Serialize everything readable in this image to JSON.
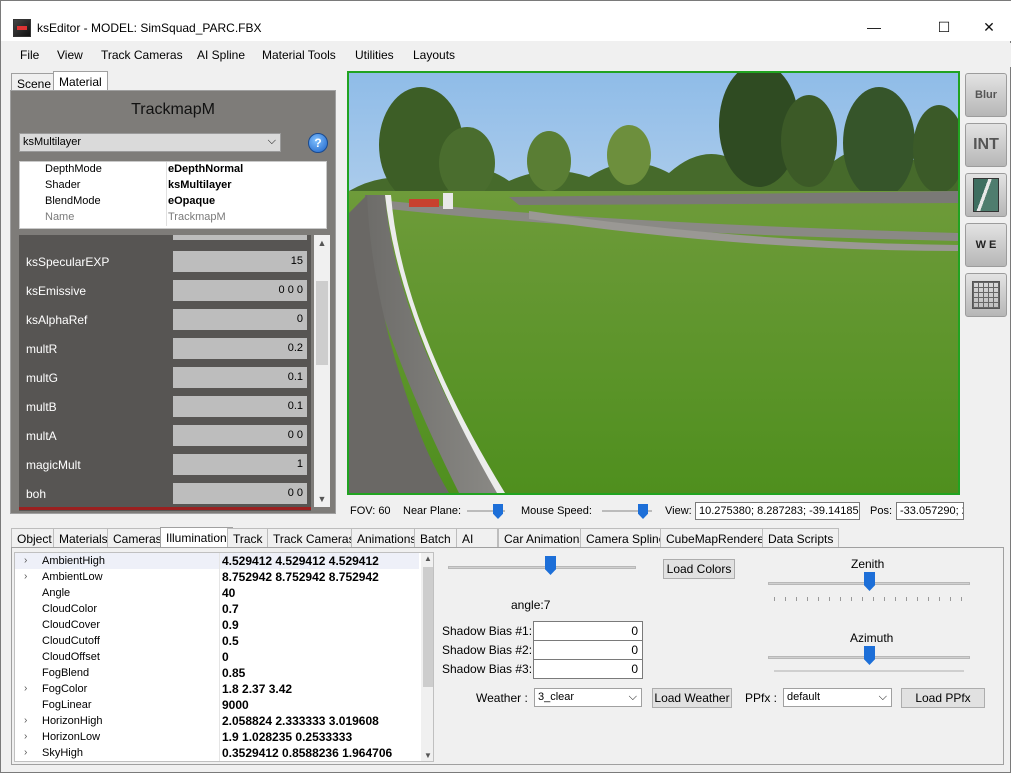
{
  "window": {
    "title": "ksEditor - MODEL: SimSquad_PARC.FBX",
    "minimize": "—",
    "maximize": "☐",
    "close": "✕"
  },
  "menu": [
    "File",
    "View",
    "Track Cameras",
    "AI Spline",
    "Material Tools",
    "Utilities",
    "Layouts"
  ],
  "left_tabs": [
    "Scene",
    "Material"
  ],
  "material": {
    "name": "TrackmapM",
    "shader_select": "ksMultilayer",
    "help_label": "?",
    "properties": [
      {
        "key": "DepthMode",
        "value": "eDepthNormal"
      },
      {
        "key": "Shader",
        "value": "ksMultilayer"
      },
      {
        "key": "BlendMode",
        "value": "eOpaque"
      },
      {
        "key": "Name",
        "value": "TrackmapM"
      }
    ],
    "params": [
      {
        "label": "ksSpecularEXP",
        "value": "15"
      },
      {
        "label": "ksEmissive",
        "value": "0 0 0"
      },
      {
        "label": "ksAlphaRef",
        "value": "0"
      },
      {
        "label": "multR",
        "value": "0.2"
      },
      {
        "label": "multG",
        "value": "0.1"
      },
      {
        "label": "multB",
        "value": "0.1"
      },
      {
        "label": "multA",
        "value": "0 0"
      },
      {
        "label": "magicMult",
        "value": "1"
      },
      {
        "label": "boh",
        "value": "0 0"
      }
    ]
  },
  "side_buttons": [
    {
      "name": "blur-icon",
      "label": "Blur"
    },
    {
      "name": "int-hr-lr-icon",
      "label": "INT"
    },
    {
      "name": "texture-icon",
      "label": ""
    },
    {
      "name": "we-lights-icon",
      "label": "W E"
    },
    {
      "name": "grid-icon",
      "label": ""
    }
  ],
  "viewport_footer": {
    "fov_label": "FOV: 60",
    "near_plane_label": "Near Plane:",
    "mouse_speed_label": "Mouse Speed:",
    "view_label": "View:",
    "view_value": "10.275380; 8.287283; -39.141850",
    "pos_label": "Pos:",
    "pos_value": "-33.057290; 2"
  },
  "bottom_tabs": [
    "Object",
    "Materials",
    "Cameras",
    "Illumination",
    "Track",
    "Track Cameras",
    "Animations",
    "Batch",
    "AI",
    "Car Animations",
    "Camera Spline",
    "CubeMapRenderer",
    "Data Scripts"
  ],
  "illumination": {
    "rows": [
      {
        "exp": "›",
        "key": "AmbientHigh",
        "value": "4.529412 4.529412 4.529412"
      },
      {
        "exp": "›",
        "key": "AmbientLow",
        "value": "8.752942 8.752942 8.752942"
      },
      {
        "exp": "",
        "key": "Angle",
        "value": "40"
      },
      {
        "exp": "",
        "key": "CloudColor",
        "value": "0.7"
      },
      {
        "exp": "",
        "key": "CloudCover",
        "value": "0.9"
      },
      {
        "exp": "",
        "key": "CloudCutoff",
        "value": "0.5"
      },
      {
        "exp": "",
        "key": "CloudOffset",
        "value": "0"
      },
      {
        "exp": "",
        "key": "FogBlend",
        "value": "0.85"
      },
      {
        "exp": "›",
        "key": "FogColor",
        "value": "1.8 2.37 3.42"
      },
      {
        "exp": "",
        "key": "FogLinear",
        "value": "9000"
      },
      {
        "exp": "›",
        "key": "HorizonHigh",
        "value": "2.058824 2.333333 3.019608"
      },
      {
        "exp": "›",
        "key": "HorizonLow",
        "value": "1.9 1.028235 0.2533333"
      },
      {
        "exp": "›",
        "key": "SkyHigh",
        "value": "0.3529412 0.8588236 1.964706"
      }
    ],
    "load_colors": "Load Colors",
    "angle_label": "angle:7",
    "zenith_label": "Zenith",
    "azimuth_label": "Azimuth",
    "shadow_bias": [
      {
        "label": "Shadow Bias #1:",
        "value": "0"
      },
      {
        "label": "Shadow Bias #2:",
        "value": "0"
      },
      {
        "label": "Shadow Bias #3:",
        "value": "0"
      }
    ],
    "weather_label": "Weather :",
    "weather_value": "3_clear",
    "load_weather": "Load Weather",
    "ppfx_label": "PPfx :",
    "ppfx_value": "default",
    "load_ppfx": "Load PPfx",
    "angle_slider_value": 0.55,
    "zenith_slider_value": 0.5,
    "azimuth_slider_value": 0.5
  },
  "colors": {
    "viewport_border": "#21a321",
    "slider_knob": "#1d6fd8",
    "param_bg": "#575553"
  }
}
